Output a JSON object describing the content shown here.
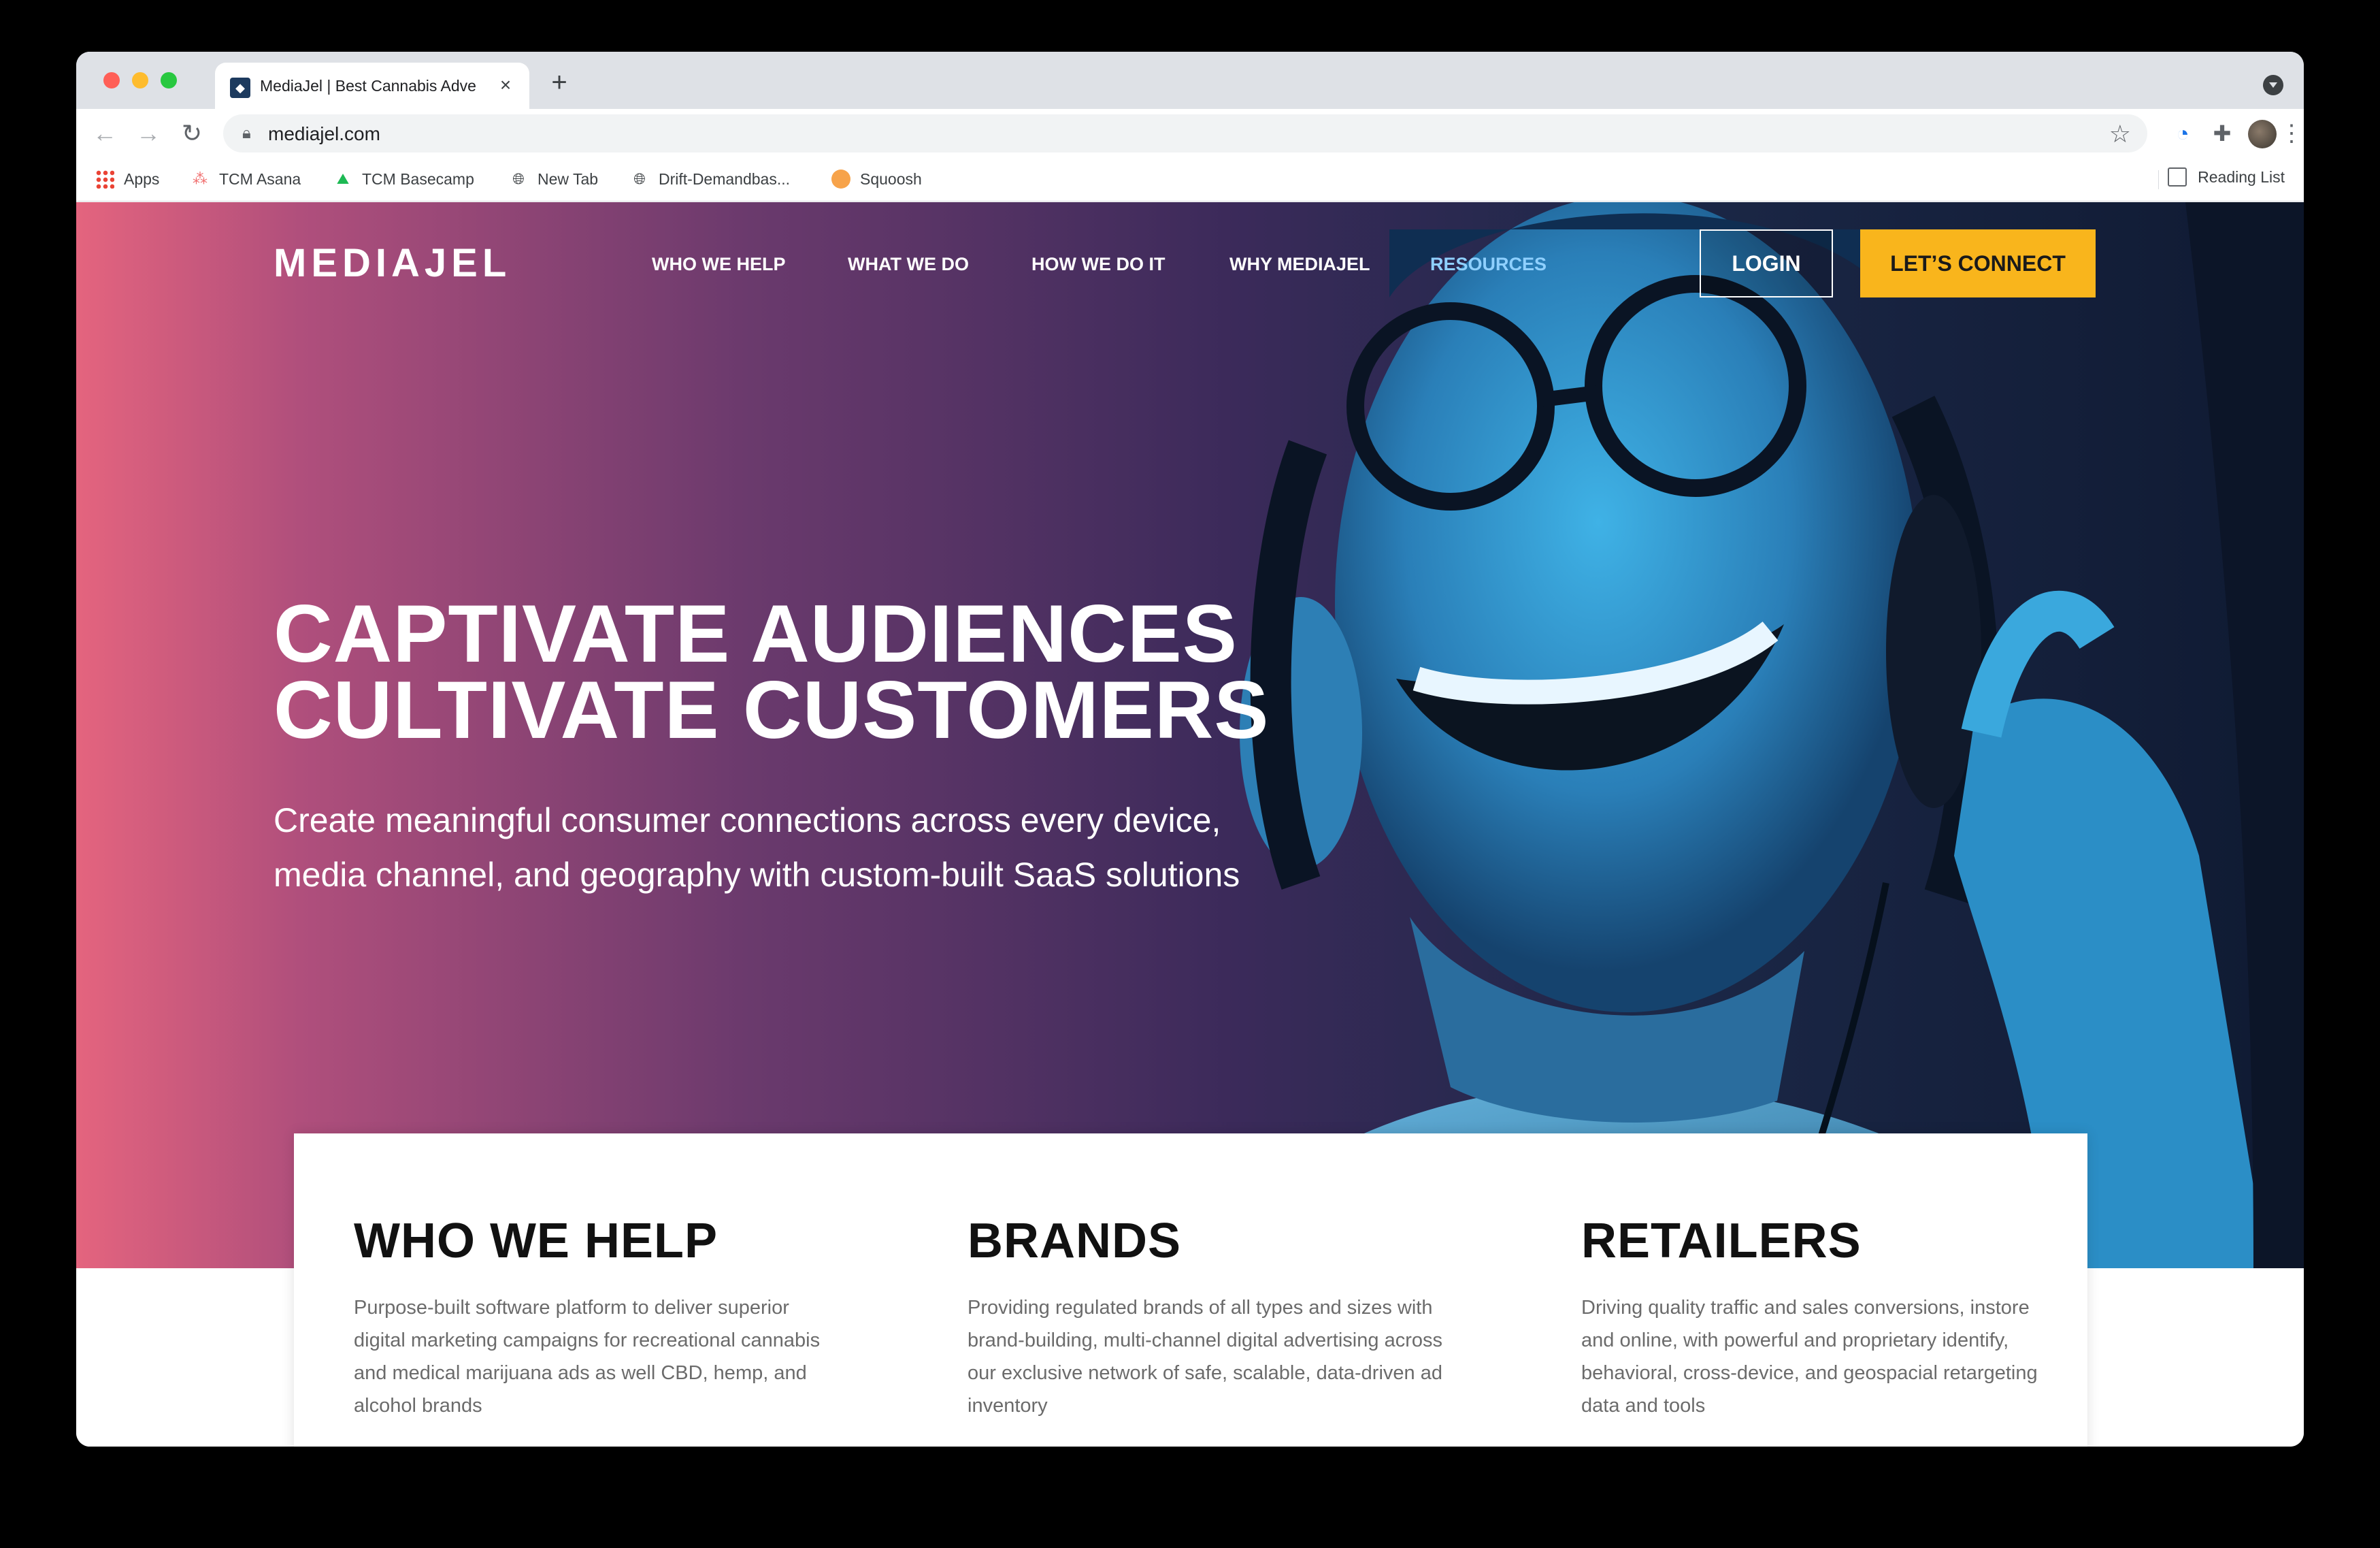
{
  "browser": {
    "tab_title": "MediaJel | Best Cannabis Adve",
    "url": "mediajel.com",
    "bookmarks": [
      {
        "label": "Apps",
        "icon": "apps-grid-icon"
      },
      {
        "label": "TCM Asana",
        "icon": "asana-icon"
      },
      {
        "label": "TCM Basecamp",
        "icon": "basecamp-icon"
      },
      {
        "label": "New Tab",
        "icon": "globe-icon"
      },
      {
        "label": "Drift-Demandbas...",
        "icon": "globe-icon"
      },
      {
        "label": "Squoosh",
        "icon": "squoosh-icon"
      }
    ],
    "reading_list": "Reading List"
  },
  "site": {
    "logo": "MEDIAJEL",
    "nav": [
      "WHO WE HELP",
      "WHAT WE DO",
      "HOW WE DO IT",
      "WHY MEDIAJEL",
      "RESOURCES"
    ],
    "login": "LOGIN",
    "connect": "LET’S CONNECT",
    "headline_line1": "CAPTIVATE AUDIENCES",
    "headline_line2": "CULTIVATE CUSTOMERS",
    "subhead_line1": "Create meaningful consumer connections across every device,",
    "subhead_line2": "media channel, and geography with custom-built SaaS solutions",
    "columns": [
      {
        "title": "WHO WE HELP",
        "text": "Purpose-built software platform to deliver superior digital marketing campaigns for recreational cannabis and medical marijuana ads as well CBD, hemp, and alcohol brands"
      },
      {
        "title": "BRANDS",
        "text": "Providing regulated brands of all types and sizes with brand-building, multi-channel digital advertising across our exclusive network of safe, scalable, data-driven ad inventory"
      },
      {
        "title": "RETAILERS",
        "text": "Driving quality traffic and sales conversions, instore and online, with powerful and proprietary identify, behavioral, cross-device, and geospacial retargeting data and tools"
      }
    ]
  },
  "colors": {
    "accent_yellow": "#f9b51c",
    "nav_active": "#8fd0ff",
    "hero_left": "#e4647e",
    "hero_right": "#0f1a32"
  }
}
